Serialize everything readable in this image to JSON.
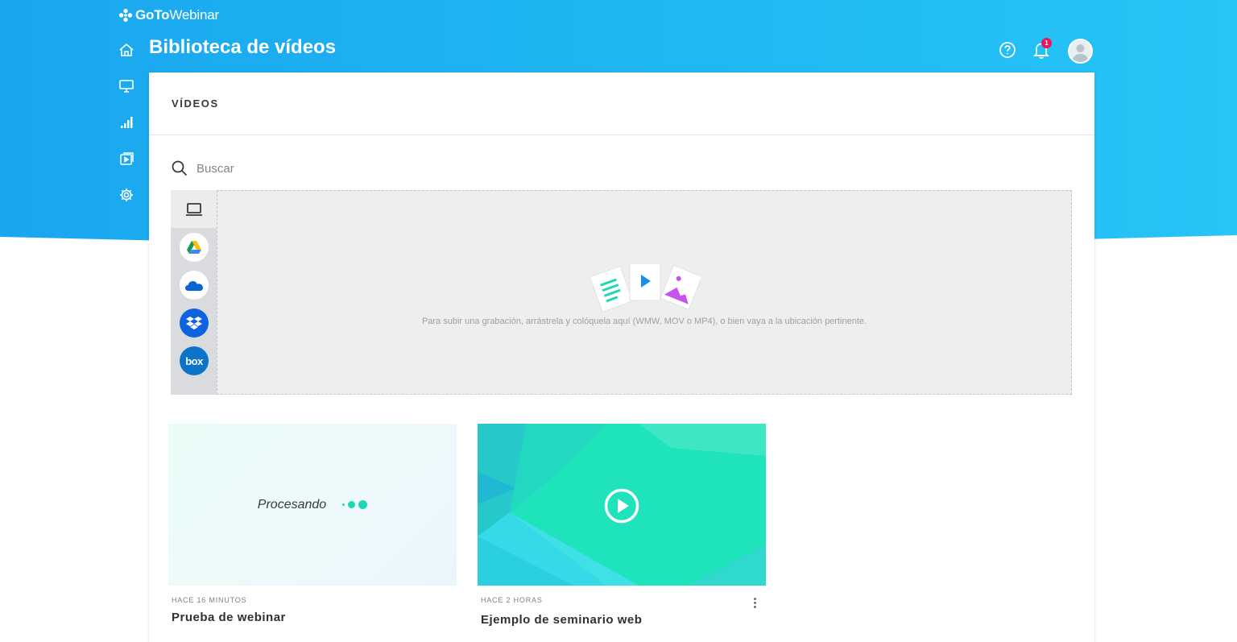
{
  "brand": {
    "logo_bold": "GoTo",
    "logo_light": "Webinar"
  },
  "header": {
    "title": "Biblioteca de vídeos",
    "notification_count": "1"
  },
  "nav": {
    "items": [
      {
        "name": "home-icon"
      },
      {
        "name": "monitor-icon"
      },
      {
        "name": "analytics-icon"
      },
      {
        "name": "video-library-icon"
      },
      {
        "name": "settings-icon"
      }
    ]
  },
  "section": {
    "title": "VÍDEOS"
  },
  "search": {
    "placeholder": "Buscar"
  },
  "upload": {
    "sources": [
      "computer-icon",
      "google-drive-icon",
      "onedrive-icon",
      "dropbox-icon",
      "box-icon"
    ],
    "box_label": "box",
    "hint": "Para subir una grabación, arrástrela y colóquela aquí (WMW, MOV o MP4), o bien vaya a la ubicación pertinente."
  },
  "videos": [
    {
      "status": "Procesando",
      "time": "HACE 16 MINUTOS",
      "title": "Prueba de webinar"
    },
    {
      "status": "",
      "time": "HACE 2 HORAS",
      "title": "Ejemplo de seminario web"
    }
  ],
  "colors": {
    "header_blue": "#1fb6f3",
    "accent_green": "#1ee3bb",
    "badge_pink": "#e8175d",
    "dropbox_blue": "#0d63df",
    "box_blue": "#0b73c8"
  }
}
